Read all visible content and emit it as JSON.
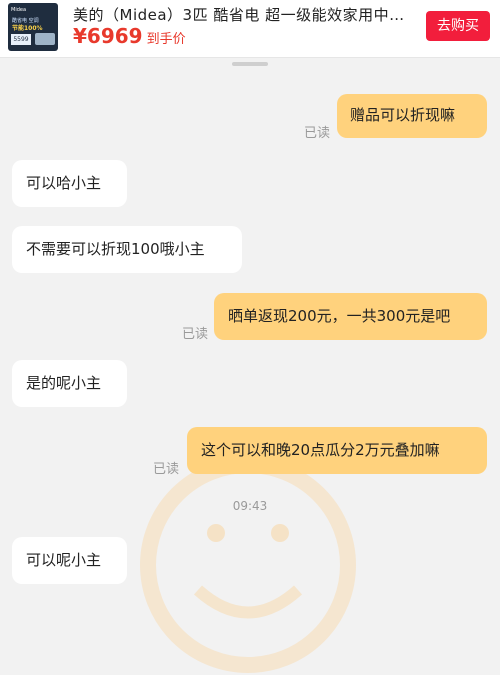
{
  "product": {
    "title": "美的（Midea）3匹 酷省电 超一级能效家用中…",
    "price": "¥6969",
    "price_label": "到手价",
    "buy_label": "去购买",
    "thumb": {
      "brand": "Midea",
      "slogan": "酷省电 空调",
      "badge": "节能100%",
      "price": "5599"
    }
  },
  "messages": [
    {
      "side": "out",
      "text": "赠品可以折现嘛",
      "read": "已读"
    },
    {
      "side": "in",
      "text": "可以哈小主"
    },
    {
      "side": "in",
      "text": "不需要可以折现100哦小主"
    },
    {
      "side": "out",
      "text": "晒单返现200元，一共300元是吧",
      "read": "已读"
    },
    {
      "side": "in",
      "text": "是的呢小主"
    },
    {
      "side": "out",
      "text": "这个可以和晚20点瓜分2万元叠加嘛",
      "read": "已读"
    },
    {
      "side": "in",
      "text": "可以呢小主"
    }
  ],
  "timestamp": "09:43",
  "colors": {
    "accent_red": "#f21e3c",
    "price_red": "#e8392c",
    "outgoing_bubble": "#ffd27d",
    "incoming_bubble": "#ffffff"
  }
}
